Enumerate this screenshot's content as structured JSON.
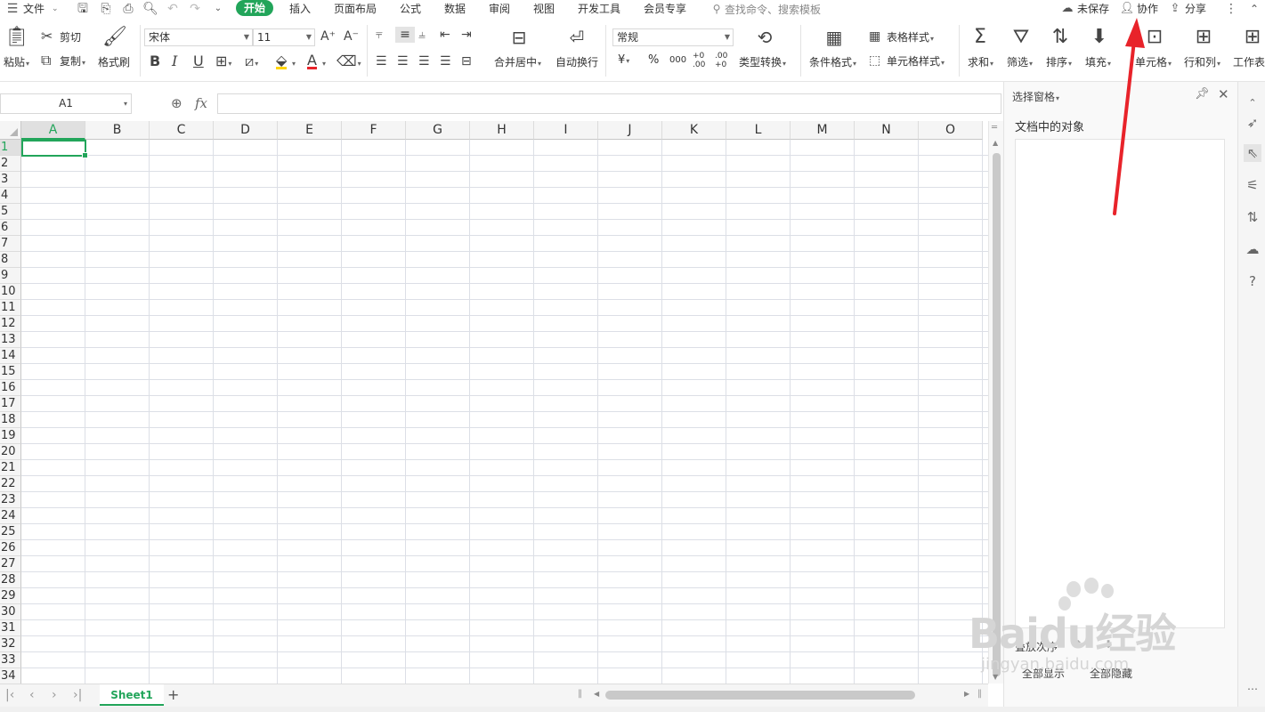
{
  "menu": {
    "file_label": "文件",
    "tabs": [
      "开始",
      "插入",
      "页面布局",
      "公式",
      "数据",
      "审阅",
      "视图",
      "开发工具",
      "会员专享"
    ],
    "search_placeholder": "查找命令、搜索模板",
    "unsaved_label": "未保存",
    "collab_label": "协作",
    "share_label": "分享"
  },
  "ribbon": {
    "paste": "粘贴",
    "cut": "剪切",
    "copy": "复制",
    "format_painter": "格式刷",
    "font_name": "宋体",
    "font_size": "11",
    "bold": "B",
    "italic": "I",
    "underline": "U",
    "merge_center": "合并居中",
    "wrap_text": "自动换行",
    "number_format": "常规",
    "currency": "¥",
    "percent": "%",
    "thousands": "000",
    "inc_decimal": "+0 .00",
    "dec_decimal": ".00 +0",
    "type_convert": "类型转换",
    "cond_format": "条件格式",
    "table_style": "表格样式",
    "cell_style": "单元格样式",
    "sum": "求和",
    "filter": "筛选",
    "sort": "排序",
    "fill": "填充",
    "cell": "单元格",
    "row_col": "行和列",
    "worksheet": "工作表"
  },
  "formula_bar": {
    "cell_ref": "A1",
    "fx_label": "fx",
    "formula_value": ""
  },
  "grid": {
    "columns": [
      "A",
      "B",
      "C",
      "D",
      "E",
      "F",
      "G",
      "H",
      "I",
      "J",
      "K",
      "L",
      "M",
      "N",
      "O"
    ],
    "rows": [
      "1",
      "2",
      "3",
      "4",
      "5",
      "6",
      "7",
      "8",
      "9",
      "10",
      "11",
      "12",
      "13",
      "14",
      "15",
      "16",
      "17",
      "18",
      "19",
      "20",
      "21",
      "22",
      "23",
      "24",
      "25",
      "26",
      "27",
      "28",
      "29",
      "30",
      "31",
      "32",
      "33",
      "34"
    ],
    "active_column": "A",
    "active_row": "1"
  },
  "sheets": {
    "active": "Sheet1",
    "add_label": "+"
  },
  "selection_pane": {
    "title": "选择窗格",
    "heading": "文档中的对象",
    "order_label": "叠放次序",
    "show_all": "全部显示",
    "hide_all": "全部隐藏"
  },
  "watermark": {
    "brand": "Baidu经验",
    "url": "jingyan.baidu.com"
  },
  "colors": {
    "accent": "#22a55a",
    "arrow": "#e8232a",
    "font_color_underline": "#e8232a",
    "highlight_underline": "#ffd400"
  }
}
